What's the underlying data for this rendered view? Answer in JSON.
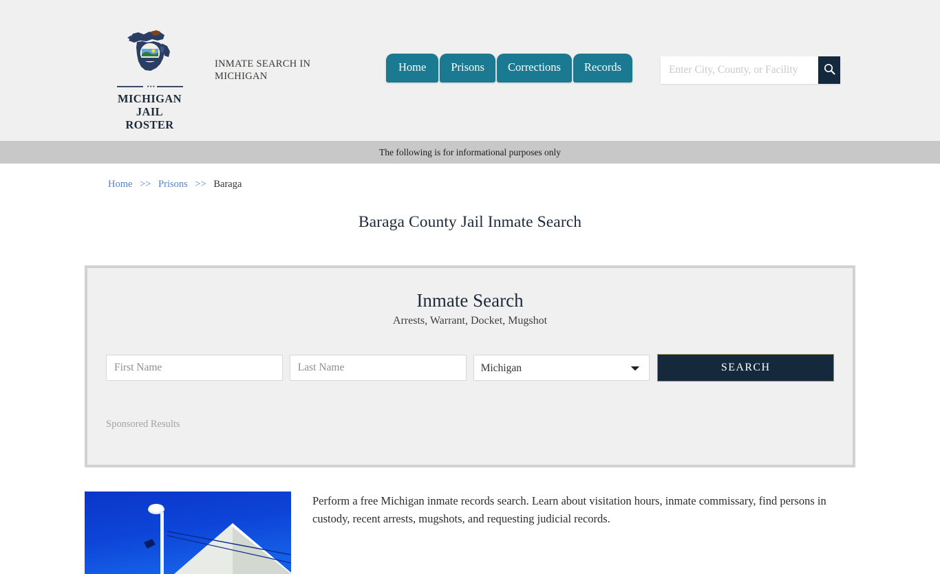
{
  "header": {
    "logo": {
      "line1": "MICHIGAN",
      "line2": "JAIL ROSTER",
      "ornament": "•••",
      "icon": "michigan-state-seal-icon"
    },
    "tagline": "INMATE SEARCH IN MICHIGAN",
    "nav": [
      {
        "label": "Home",
        "name": "nav-tab-home"
      },
      {
        "label": "Prisons",
        "name": "nav-tab-prisons"
      },
      {
        "label": "Corrections",
        "name": "nav-tab-corrections"
      },
      {
        "label": "Records",
        "name": "nav-tab-records"
      }
    ],
    "search": {
      "placeholder": "Enter City, County, or Facility",
      "value": "",
      "button_icon": "search-icon"
    },
    "colors": {
      "background": "#f0f0f0",
      "nav_tab": "#1b7a91",
      "search_button": "#15293d"
    }
  },
  "info_bar": {
    "text": "The following is for informational purposes only",
    "background": "#c8c8c8"
  },
  "breadcrumb": {
    "items": [
      {
        "label": "Home",
        "link": true
      },
      {
        "label": "Prisons",
        "link": true
      },
      {
        "label": "Baraga",
        "link": false
      }
    ],
    "separator": ">>"
  },
  "page": {
    "title": "Baraga County Jail Inmate Search"
  },
  "search_panel": {
    "title": "Inmate Search",
    "subtitle": "Arrests, Warrant, Docket, Mugshot",
    "first_name": {
      "placeholder": "First Name",
      "value": ""
    },
    "last_name": {
      "placeholder": "Last Name",
      "value": ""
    },
    "state": {
      "selected": "Michigan",
      "options": [
        "Michigan"
      ]
    },
    "submit_label": "SEARCH",
    "sponsored_label": "Sponsored Results",
    "colors": {
      "panel_background": "#f0f0f0",
      "panel_border": "#d2d2d2",
      "submit_background": "#15293d",
      "submit_border": "#8e8b55"
    }
  },
  "lower": {
    "thumbnail_alt": "jail-building-photo",
    "paragraph": "Perform a free Michigan inmate records search. Learn about visitation hours, inmate commissary, find persons in custody, recent arrests, mugshots, and requesting judicial records."
  }
}
